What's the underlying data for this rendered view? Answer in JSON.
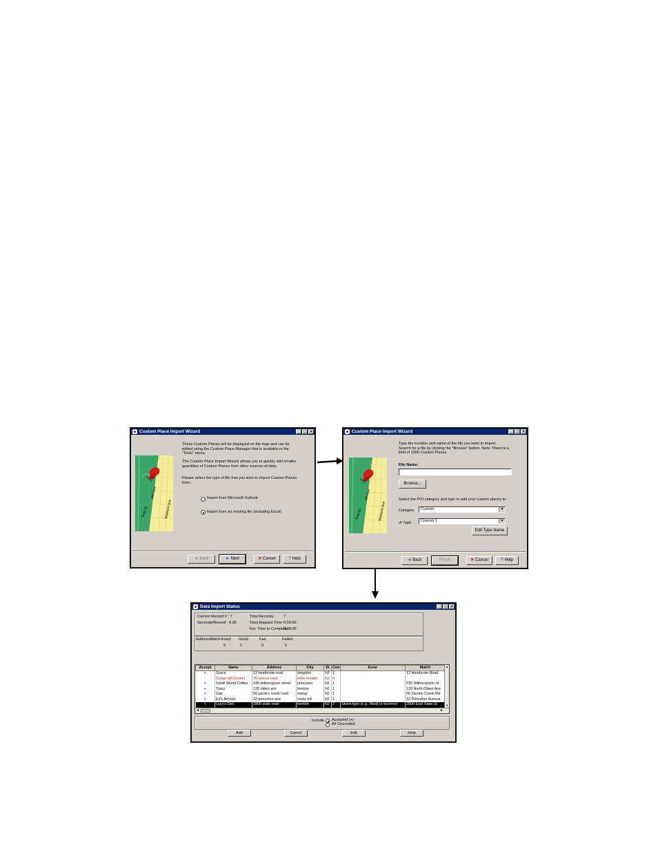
{
  "win1": {
    "title": "Custom Place Import Wizard",
    "intro1": "These Custom Places will be displayed on the map and can be edited using the Custom Place Manager that is available in the \"Tools\" menu.",
    "intro2": "The Custom Place Import Wizard allows you to quickly add smaller quantities of Custom Places from other sources of data.",
    "intro3": "Please select the type of file that you wish to import Custom Places from :",
    "option1": "Import from Microsoft Outlook",
    "option2": "Import from an existing file (including Excel)",
    "back": "Back",
    "next": "Next",
    "cancel": "Cancel",
    "help": "Help"
  },
  "win2": {
    "title": "Custom Place Import Wizard",
    "intro": "Type the location and name of the file you want to import. Search for a file by clicking the \"Browse\" button. Note: There is a limit of 1000 Custom Places.",
    "filename_label": "File Name:",
    "filename_value": "",
    "browse": "Browse...",
    "poi_text": "Select the POI category and type to add your custom places to :",
    "category_label": "Category",
    "category_value": "Custom",
    "type_label": "of Type",
    "type_value": "Custom 1",
    "edit_type": "Edit Type Name",
    "back": "Back",
    "finish": "Finish",
    "cancel": "Cancel",
    "help": "Help"
  },
  "win3": {
    "title": "Data Import Status",
    "current_record": "Current Record # : 7",
    "seconds_record": "Seconds/Record : 0.06",
    "total_records_label": "Total Records :",
    "total_records_value": "7",
    "elapsed_label": "Total Elapsed Time :",
    "elapsed_value": "0:00:00",
    "est_label": "Est. Time to Complete :",
    "est_value": "0:00:00",
    "match_label": "AddressMatch :",
    "match_headers": [
      "Exact",
      "Good",
      "Fair",
      "Failed"
    ],
    "match_values": [
      "5",
      "1",
      "0",
      "1"
    ],
    "columns": [
      "Accept",
      "Name",
      "Address",
      "City",
      "St",
      "Conf",
      "Error",
      "Match"
    ],
    "rows": [
      {
        "accept": "+",
        "name": "Grace",
        "address": "12 heathcote road",
        "city": "kingston",
        "st": "NJ",
        "conf": "1",
        "error": "",
        "match": "12 Heathcote Road"
      },
      {
        "accept": "",
        "name": "Cedar Hill Kennel",
        "address": "20 sunset road",
        "city": "belle meade",
        "st": "NJ",
        "conf": "4",
        "error": "",
        "match": ""
      },
      {
        "accept": "+",
        "name": "Small World Coffee",
        "address": "230 witherspoon street",
        "city": "princeton",
        "st": "NJ",
        "conf": "1",
        "error": "",
        "match": "230 Witherspoon St"
      },
      {
        "accept": "+",
        "name": "Tracy",
        "address": "120 olden ave",
        "city": "trenton",
        "st": "NJ",
        "conf": "1",
        "error": "",
        "match": "120 North Olden Ave"
      },
      {
        "accept": "+",
        "name": "Gail",
        "address": "56 jacob's creek road",
        "city": "ewing",
        "st": "NJ",
        "conf": "1",
        "error": "",
        "match": "56 Jacobs Creek Rd"
      },
      {
        "accept": "+",
        "name": "Ed's Amoco",
        "address": "32 princeton ave",
        "city": "rocky hill",
        "st": "NJ",
        "conf": "1",
        "error": "",
        "match": "32 Princeton Avenue"
      },
      {
        "accept": "+",
        "name": "Lucy's Deli",
        "address": "2800 state road",
        "city": "trenton",
        "st": "NJ",
        "conf": "2",
        "error": "Street type (e.g., Blvd) is incorrect",
        "match": "2800 East State St"
      }
    ],
    "include_label": "Include",
    "include_opt1": "Accepted (+)",
    "include_opt2": "All Geocoded",
    "add": "Add",
    "cancel": "Cancel",
    "edit": "Edit",
    "help": "Help"
  },
  "map_labels": {
    "street1": "East Dr",
    "street2": "6th Ave",
    "street3": "Madison Ave"
  },
  "colors": {
    "title_bar": "#0a246a",
    "dialog_bg": "#d4d0c8",
    "map_green": "#3aa66a",
    "map_yellow": "#f4ec9a",
    "pin_red": "#d21b1b",
    "error_row": "#d02020"
  }
}
